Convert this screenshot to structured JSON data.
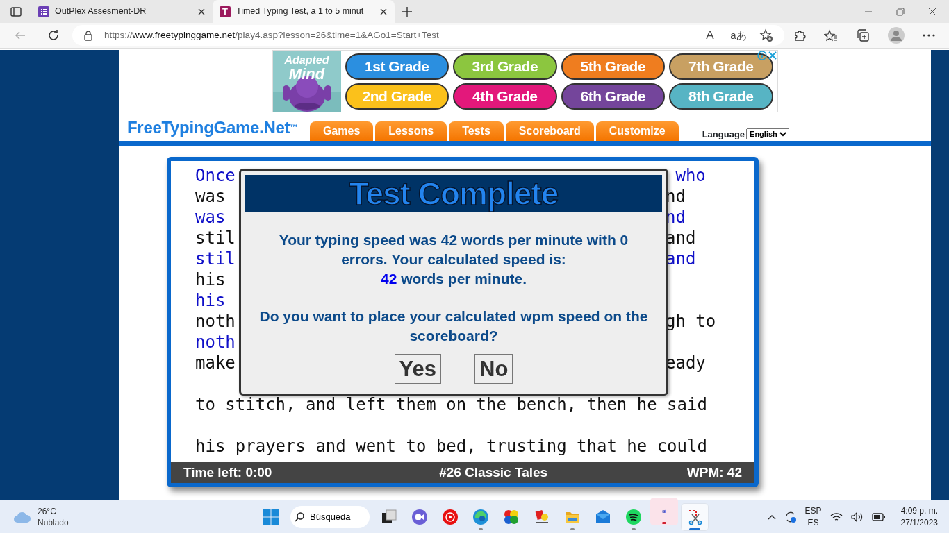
{
  "browser": {
    "tabs": [
      {
        "title": "OutPlex Assesment-DR",
        "selected": false
      },
      {
        "title": "Timed Typing Test, a 1 to 5 minut",
        "icon_letter": "T",
        "selected": true
      }
    ],
    "url_scheme": "https://",
    "url_host": "www.freetypinggame.net",
    "url_path": "/play4.asp?lesson=26&time=1&AGo1=Start+Test",
    "read_aloud_glyph": "A",
    "translate_glyph": "aあ"
  },
  "ad": {
    "logo_line1": "Adapted",
    "logo_line2": "Mind",
    "grades": [
      {
        "label": "1st Grade",
        "color": "#2b8fe0"
      },
      {
        "label": "3rd Grade",
        "color": "#8cc63f"
      },
      {
        "label": "5th Grade",
        "color": "#ef7d1f"
      },
      {
        "label": "7th Grade",
        "color": "#c8a062"
      },
      {
        "label": "2nd Grade",
        "color": "#fbc11b"
      },
      {
        "label": "4th Grade",
        "color": "#e3187b"
      },
      {
        "label": "6th Grade",
        "color": "#74459b"
      },
      {
        "label": "8th Grade",
        "color": "#57b4c4"
      }
    ]
  },
  "site": {
    "logo": "FreeTypingGame.Net$^{™}$",
    "nav": [
      "Games",
      "Lessons",
      "Tests",
      "Scoreboard",
      "Customize"
    ],
    "language_label": "Language",
    "language_value": "English"
  },
  "typing": {
    "lines": [
      {
        "kind": "typed",
        "left": "Once",
        "right": " who"
      },
      {
        "kind": "source",
        "left": "was",
        "right": "nd"
      },
      {
        "kind": "typed",
        "left": "was",
        "right": "nd"
      },
      {
        "kind": "source",
        "left": "stil",
        "right": "and"
      },
      {
        "kind": "typed",
        "left": "stil",
        "right": "and"
      },
      {
        "kind": "source",
        "left": "his"
      },
      {
        "kind": "typed",
        "left": "his"
      },
      {
        "kind": "source",
        "left": "noth",
        "right": "gh to"
      },
      {
        "kind": "typed",
        "left": "noth"
      },
      {
        "kind": "source",
        "left": "make",
        "right": "eady"
      },
      {
        "kind": "blank"
      },
      {
        "kind": "source",
        "left": "to stitch, and left them on the bench, then he said"
      },
      {
        "kind": "blank"
      },
      {
        "kind": "source",
        "left": "his prayers and went to bed, trusting that he could"
      }
    ],
    "status": {
      "time_left": "Time left: 0:00",
      "lesson": "#26 Classic Tales",
      "wpm": "WPM: 42"
    }
  },
  "dialog": {
    "title": "Test Complete",
    "message": "Your typing speed was 42 words per minute with 0 errors. Your calculated speed is:",
    "speed_value": "42",
    "speed_unit": "words per minute.",
    "question": "Do you want to place your calculated wpm speed on the scoreboard?",
    "buttons": [
      "Yes",
      "No"
    ]
  },
  "taskbar": {
    "temperature": "26°C",
    "weather": "Nublado",
    "search": "Búsqueda",
    "apps": [
      {
        "kind": "taskview",
        "running": false,
        "attention": false,
        "selected": false
      },
      {
        "kind": "video",
        "running": false,
        "attention": false,
        "selected": false
      },
      {
        "kind": "play",
        "running": false,
        "attention": false,
        "selected": false
      },
      {
        "kind": "browser",
        "running": true,
        "attention": false,
        "selected": false
      },
      {
        "kind": "circles",
        "running": false,
        "attention": false,
        "selected": false
      },
      {
        "kind": "game",
        "running": false,
        "attention": false,
        "selected": false
      },
      {
        "kind": "folder",
        "running": true,
        "attention": false,
        "selected": false
      },
      {
        "kind": "mail",
        "running": false,
        "attention": false,
        "selected": false
      },
      {
        "kind": "music",
        "running": true,
        "attention": false,
        "selected": false
      },
      {
        "kind": "chat",
        "running": true,
        "attention": true,
        "selected": false
      },
      {
        "kind": "snip",
        "running": true,
        "attention": false,
        "selected": true
      }
    ],
    "lang_top": "ESP",
    "lang_bottom": "ES",
    "time": "4:09 p. m.",
    "date": "27/1/2023"
  }
}
